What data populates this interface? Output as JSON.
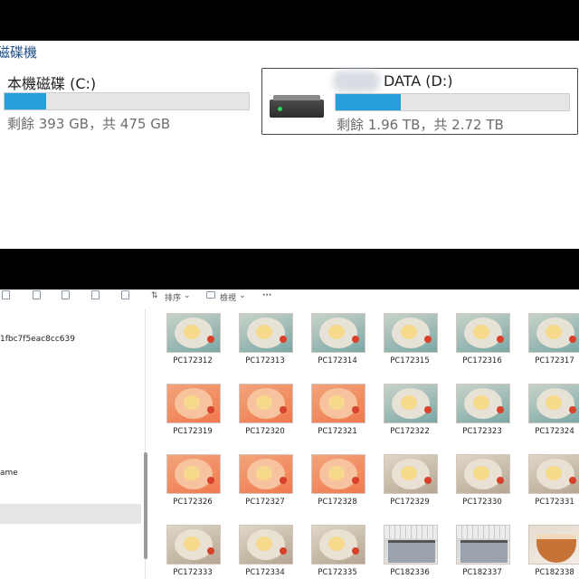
{
  "top": {
    "section_title": "磁碟機",
    "drives": [
      {
        "name": "本機磁碟 (C:)",
        "space_text": "剩餘 393 GB，共 475 GB",
        "used_fraction": 0.17
      },
      {
        "name": "DATA (D:)",
        "space_text": "剩餘 1.96 TB，共 2.72 TB",
        "used_fraction": 0.28
      }
    ],
    "colors": {
      "usage_fill": "#26a0da",
      "title": "#1f4e8c"
    }
  },
  "toolbar": {
    "sort_label": "排序",
    "view_label": "檢視",
    "more_label": "···",
    "icons": [
      "copy-icon",
      "paste-icon",
      "rename-icon",
      "share-icon",
      "delete-icon",
      "sort-icon",
      "view-icon"
    ]
  },
  "nav": {
    "id_text": "1fbc7f5eac8cc639",
    "name_text": "ame"
  },
  "files": [
    {
      "name": "PC172312",
      "kind": "cake"
    },
    {
      "name": "PC172313",
      "kind": "cake"
    },
    {
      "name": "PC172314",
      "kind": "cake"
    },
    {
      "name": "PC172315",
      "kind": "cake"
    },
    {
      "name": "PC172316",
      "kind": "cake"
    },
    {
      "name": "PC172317",
      "kind": "cake"
    },
    {
      "name": "PC172319",
      "kind": "birthday"
    },
    {
      "name": "PC172320",
      "kind": "birthday"
    },
    {
      "name": "PC172321",
      "kind": "birthday"
    },
    {
      "name": "PC172322",
      "kind": "cake"
    },
    {
      "name": "PC172323",
      "kind": "cake"
    },
    {
      "name": "PC172324",
      "kind": "cake"
    },
    {
      "name": "PC172326",
      "kind": "birthday"
    },
    {
      "name": "PC172327",
      "kind": "birthday"
    },
    {
      "name": "PC172328",
      "kind": "birthday"
    },
    {
      "name": "PC172329",
      "kind": "table"
    },
    {
      "name": "PC172330",
      "kind": "table"
    },
    {
      "name": "PC172331",
      "kind": "table"
    },
    {
      "name": "PC172333",
      "kind": "table"
    },
    {
      "name": "PC172334",
      "kind": "table"
    },
    {
      "name": "PC172335",
      "kind": "table"
    },
    {
      "name": "PC182336",
      "kind": "stove"
    },
    {
      "name": "PC182337",
      "kind": "stove"
    },
    {
      "name": "PC182338",
      "kind": "bowl"
    }
  ]
}
